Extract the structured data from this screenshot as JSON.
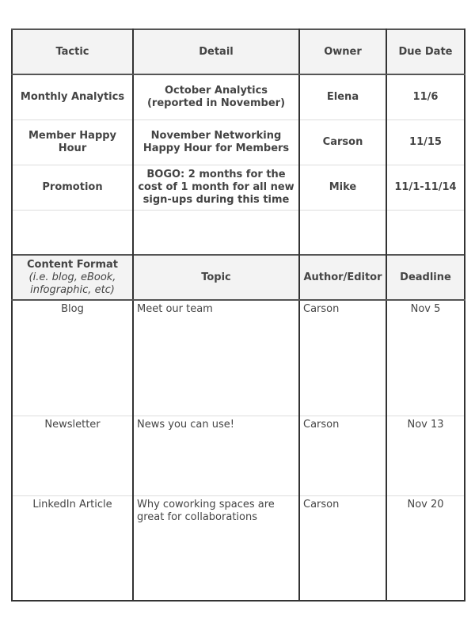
{
  "section1": {
    "headers": [
      "Tactic",
      "Detail",
      "Owner",
      "Due Date"
    ],
    "rows": [
      [
        "Monthly Analytics",
        "October Analytics (reported in November)",
        "Elena",
        "11/6"
      ],
      [
        "Member Happy Hour",
        "November Networking Happy Hour for Members",
        "Carson",
        "11/15"
      ],
      [
        "Promotion",
        "BOGO: 2 months for the cost of 1 month for all new sign-ups during this time",
        "Mike",
        "11/1-11/14"
      ],
      [
        "",
        "",
        "",
        ""
      ]
    ]
  },
  "section2": {
    "headers": [
      "Content Format",
      "(i.e. blog, eBook, infographic, etc)",
      "Topic",
      "Author/Editor",
      "Deadline"
    ],
    "rows": [
      [
        "Blog",
        "Meet our team",
        "Carson",
        "Nov 5"
      ],
      [
        "Newsletter",
        "News you can use!",
        "Carson",
        "Nov 13"
      ],
      [
        "LinkedIn Article",
        "Why coworking spaces are great for collaborations",
        "Carson",
        "Nov 20"
      ]
    ]
  }
}
